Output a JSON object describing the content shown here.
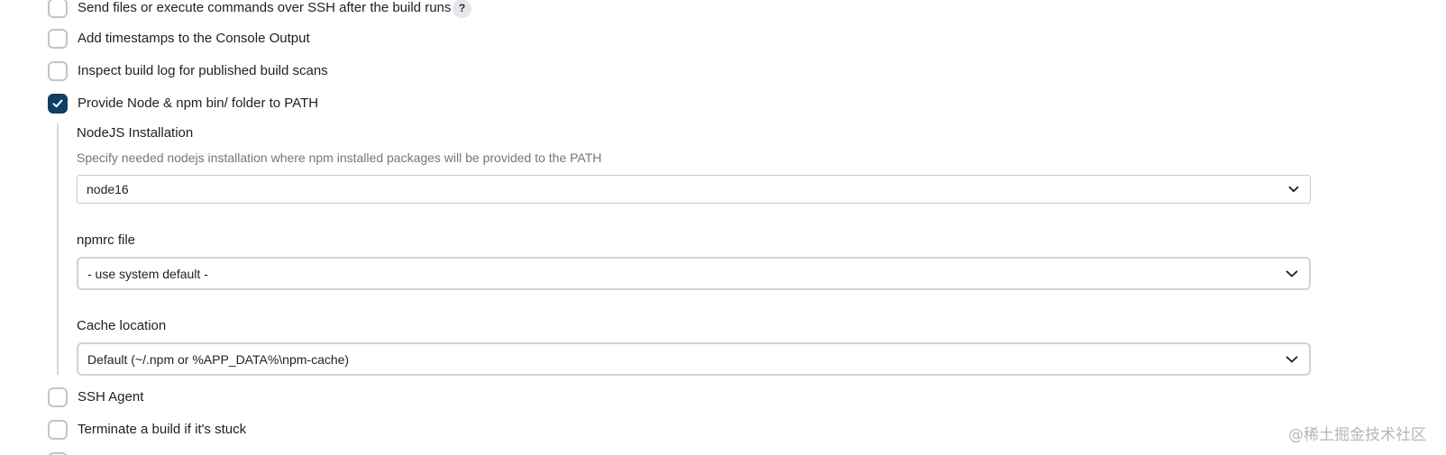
{
  "options": {
    "ssh_publish": {
      "label": "Send files or execute commands over SSH after the build runs",
      "checked": false,
      "help": "?"
    },
    "timestamps": {
      "label": "Add timestamps to the Console Output",
      "checked": false
    },
    "build_scans": {
      "label": "Inspect build log for published build scans",
      "checked": false
    },
    "node_path": {
      "label": "Provide Node & npm bin/ folder to PATH",
      "checked": true
    },
    "ssh_agent": {
      "label": "SSH Agent",
      "checked": false
    },
    "terminate_stuck": {
      "label": "Terminate a build if it's stuck",
      "checked": false
    }
  },
  "node_section": {
    "installation": {
      "label": "NodeJS Installation",
      "description": "Specify needed nodejs installation where npm installed packages will be provided to the PATH",
      "value": "node16"
    },
    "npmrc": {
      "label": "npmrc file",
      "value": "- use system default -"
    },
    "cache": {
      "label": "Cache location",
      "value": "Default (~/.npm or %APP_DATA%\\npm-cache)"
    }
  },
  "colors": {
    "checked_bg": "#123e62",
    "checkbox_border": "#c3c3cc",
    "description_text": "#757584"
  },
  "watermark": "@稀土掘金技术社区"
}
